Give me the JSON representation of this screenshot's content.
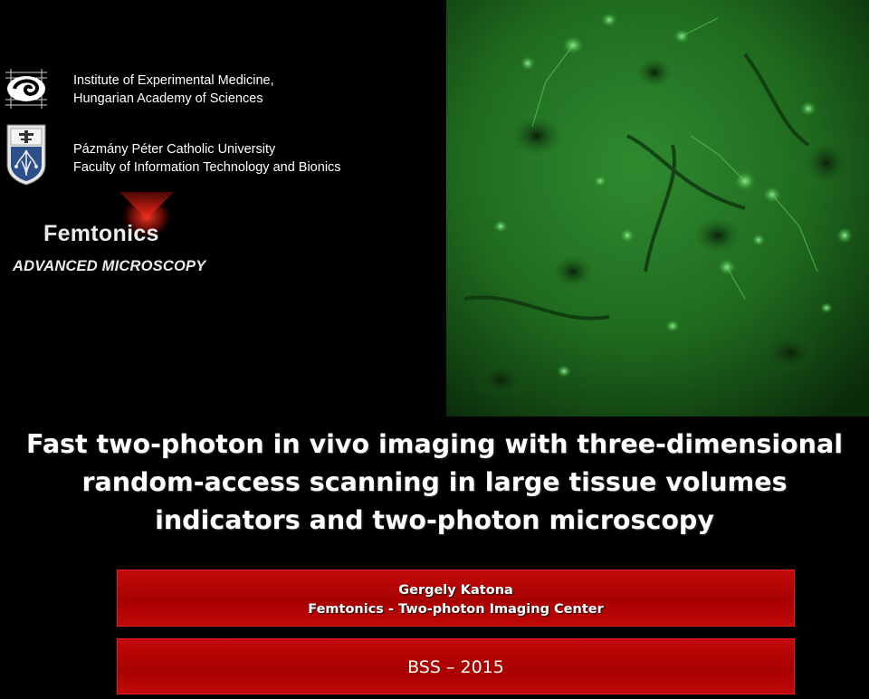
{
  "institutions": [
    {
      "logo": "koki-logo",
      "line1": "Institute of Experimental Medicine,",
      "line2": "Hungarian Academy of Sciences"
    },
    {
      "logo": "ppke-logo",
      "line1": "Pázmány Péter Catholic University",
      "line2": "Faculty of Information Technology and Bionics"
    }
  ],
  "femtonics": {
    "brand": "Femtonics",
    "tagline": "ADVANCED MICROSCOPY"
  },
  "microscopy_image": {
    "description_icon": "two-photon-micrograph",
    "color": "#2fa32f"
  },
  "title": {
    "line1": "Fast two-photon in vivo imaging with three-dimensional",
    "line2": "random-access scanning in large tissue volumes",
    "line3": "indicators and two-photon microscopy"
  },
  "author": {
    "name": "Gergely Katona",
    "affiliation": "Femtonics  - Two-photon Imaging Center"
  },
  "event": {
    "label": "BSS – 2015"
  },
  "colors": {
    "background": "#000000",
    "box_red": "#b50505",
    "text": "#ffffff"
  }
}
